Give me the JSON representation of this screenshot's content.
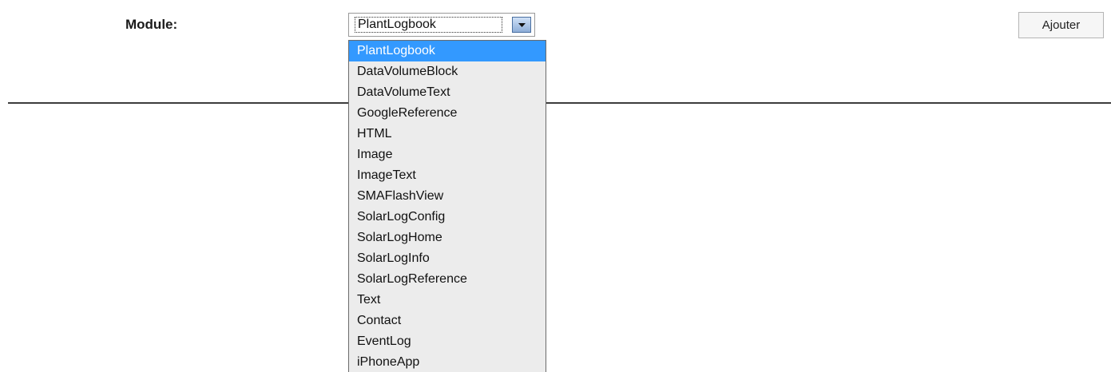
{
  "form": {
    "module_label": "Module:",
    "selected_value": "PlantLogbook",
    "add_button_label": "Ajouter"
  },
  "dropdown": {
    "selected_index": 0,
    "items": [
      "PlantLogbook",
      "DataVolumeBlock",
      "DataVolumeText",
      "GoogleReference",
      "HTML",
      "Image",
      "ImageText",
      "SMAFlashView",
      "SolarLogConfig",
      "SolarLogHome",
      "SolarLogInfo",
      "SolarLogReference",
      "Text",
      "Contact",
      "EventLog",
      "iPhoneApp"
    ]
  },
  "colors": {
    "selection_highlight": "#3399ff",
    "list_background": "#ececec"
  },
  "icons": {
    "dropdown_arrow": "chevron-down-icon"
  }
}
